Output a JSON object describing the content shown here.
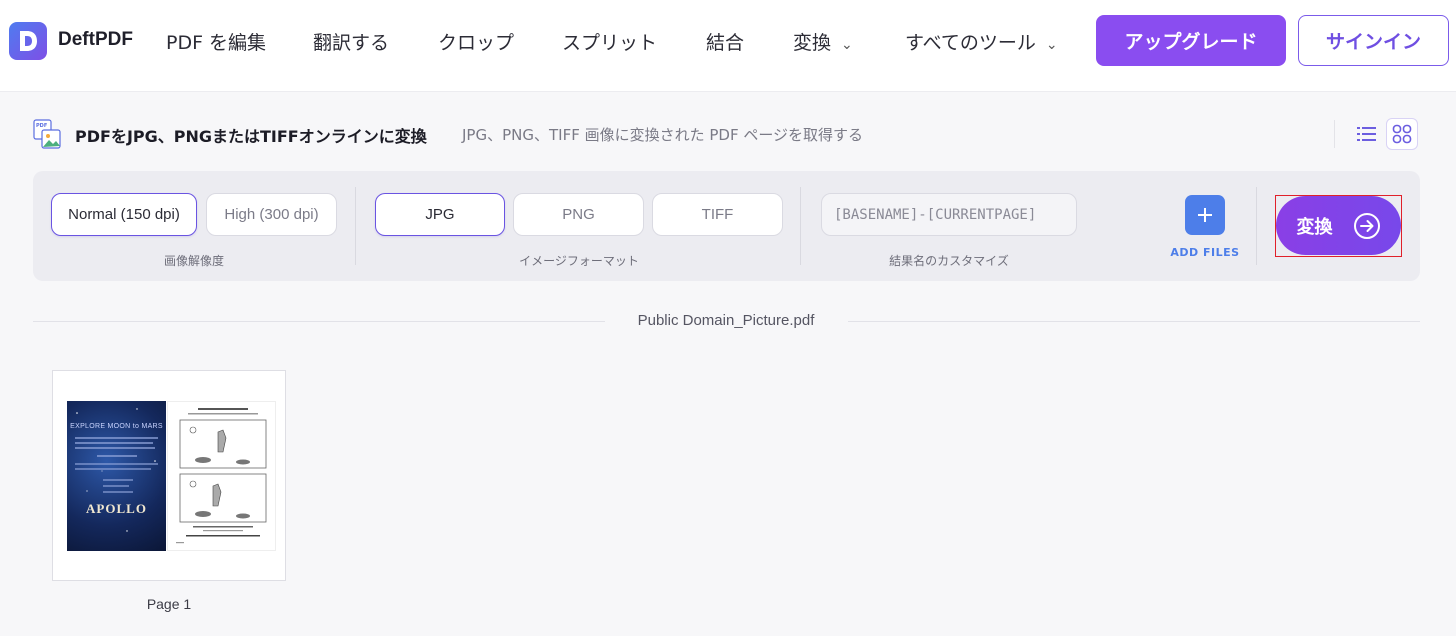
{
  "brand": {
    "name": "DeftPDF"
  },
  "nav": {
    "items": [
      {
        "label": "PDF を編集",
        "has_dropdown": false
      },
      {
        "label": "翻訳する",
        "has_dropdown": false
      },
      {
        "label": "クロップ",
        "has_dropdown": false
      },
      {
        "label": "スプリット",
        "has_dropdown": false
      },
      {
        "label": "結合",
        "has_dropdown": false
      },
      {
        "label": "変換",
        "has_dropdown": true
      },
      {
        "label": "すべてのツール",
        "has_dropdown": true
      }
    ],
    "upgrade_label": "アップグレード",
    "signin_label": "サインイン"
  },
  "page": {
    "title": "PDFをJPG、PNGまたはTIFFオンラインに変換",
    "subtitle": "JPG、PNG、TIFF 画像に変換された PDF ページを取得する",
    "active_view": "grid"
  },
  "options": {
    "resolution": {
      "label": "画像解像度",
      "choices": [
        "Normal (150 dpi)",
        "High (300 dpi)"
      ],
      "selected": "Normal (150 dpi)"
    },
    "format": {
      "label": "イメージフォーマット",
      "choices": [
        "JPG",
        "PNG",
        "TIFF"
      ],
      "selected": "JPG"
    },
    "result_name": {
      "label": "結果名のカスタマイズ",
      "value": "[BASENAME]-[CURRENTPAGE]"
    },
    "add_files_label": "ADD FILES",
    "convert_label": "変換"
  },
  "file": {
    "name": "Public Domain_Picture.pdf",
    "pages": [
      {
        "label": "Page 1",
        "thumb_title": "EXPLORE MOON to MARS",
        "thumb_logo": "APOLLO"
      }
    ]
  },
  "colors": {
    "accent": "#8a4df0",
    "add_button": "#4d7ee9",
    "highlight": "#e0202a"
  }
}
